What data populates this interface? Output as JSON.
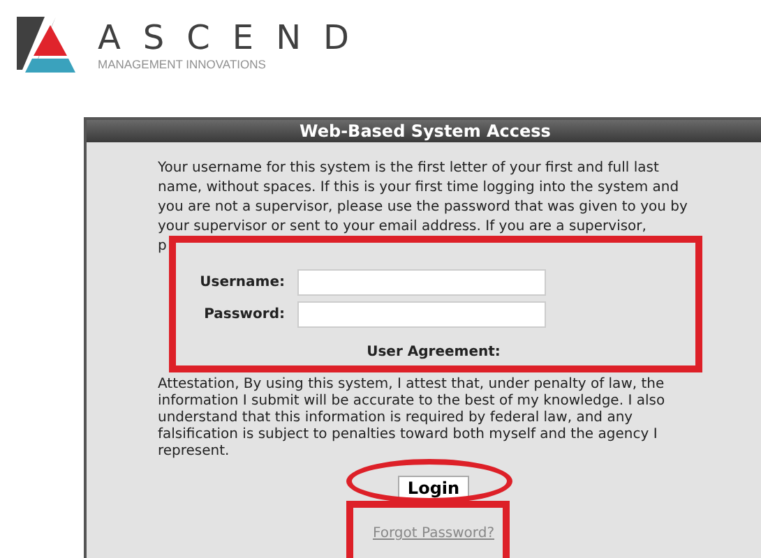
{
  "logo": {
    "name": "ASCEND",
    "tagline": "MANAGEMENT INNOVATIONS"
  },
  "panel": {
    "title": "Web-Based System Access",
    "intro": "Your username for this system is the first letter of your first and full last name, without spaces. If this is your first time logging into the system and you are not a supervisor, please use the password that was given to you by your supervisor or sent to your email address. If you are a supervisor,",
    "intro_cut": "p",
    "fields": [
      {
        "label": "Username:"
      },
      {
        "label": "Password:"
      }
    ],
    "agreement_title": "User Agreement:",
    "agreement": "Attestation, By using this system, I attest that, under penalty of law, the information I submit will be accurate to the best of my knowledge. I also understand that this information is required by federal law, and any falsification is subject to penalties toward both myself and the agency I represent.",
    "login_button": "Login",
    "forgot_link": "Forgot Password?"
  }
}
